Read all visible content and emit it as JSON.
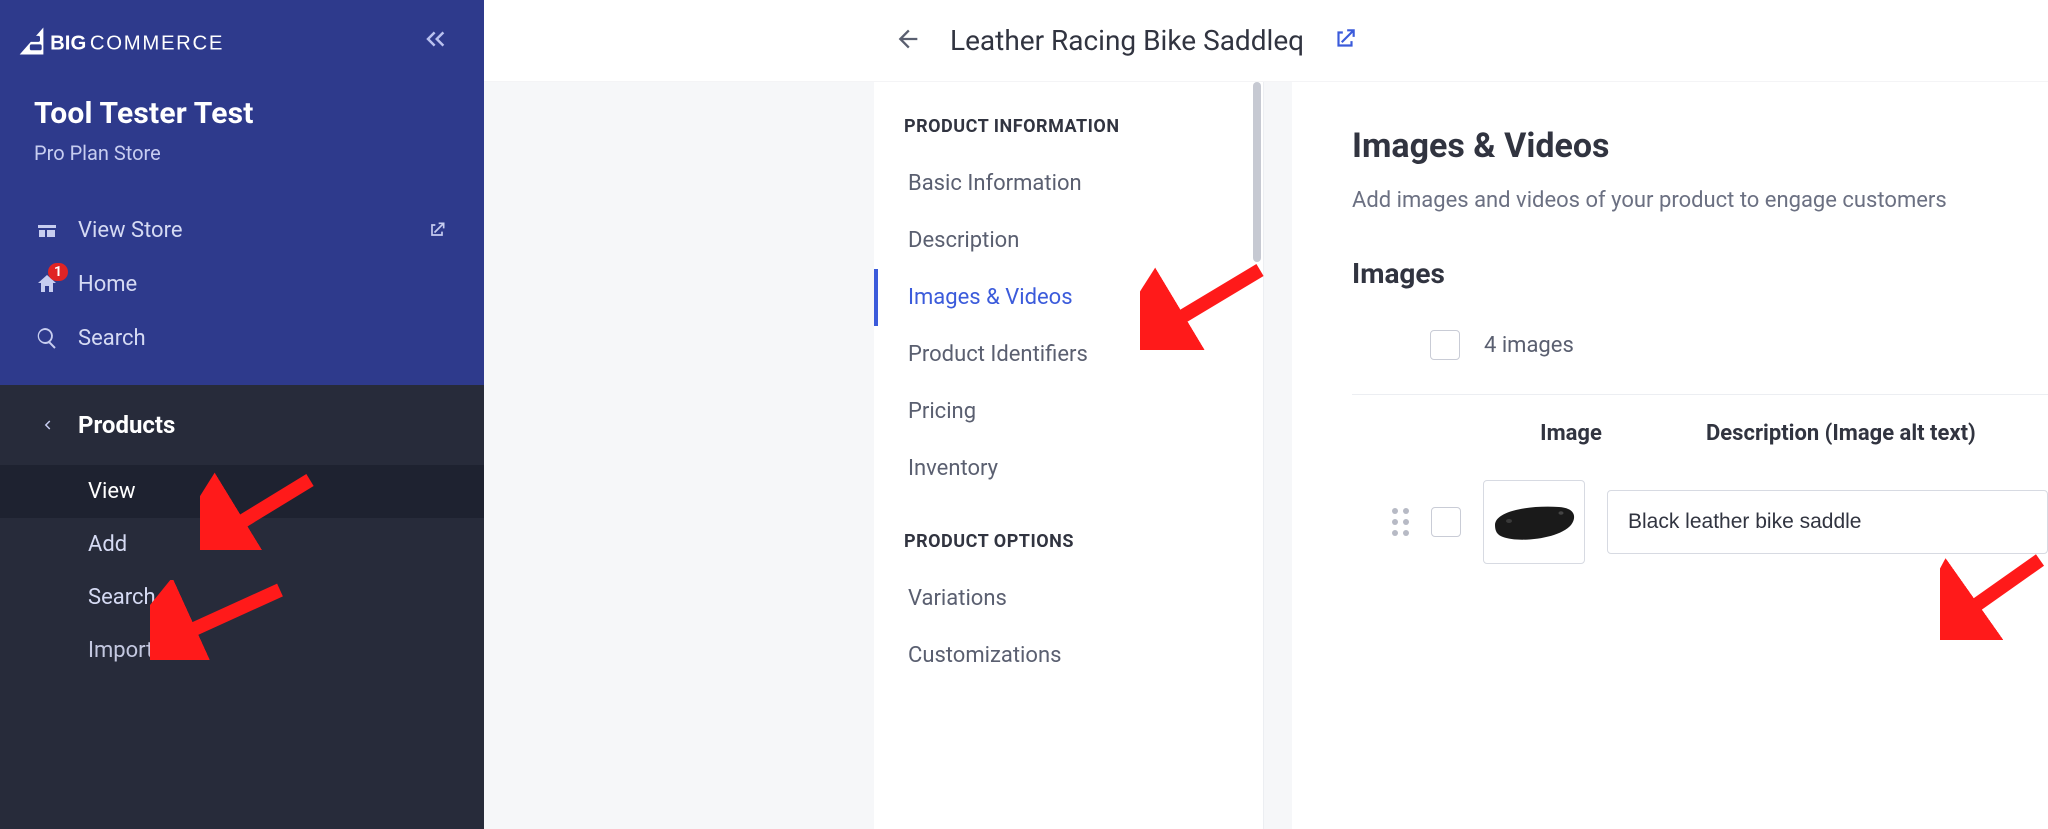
{
  "brand": {
    "name": "BIGCOMMERCE"
  },
  "store": {
    "name": "Tool Tester Test",
    "plan": "Pro Plan Store"
  },
  "sidebar": {
    "view_store": "View Store",
    "home": "Home",
    "home_badge": "1",
    "search": "Search",
    "products": {
      "label": "Products",
      "view": "View",
      "add": "Add",
      "search": "Search",
      "import": "Import"
    }
  },
  "header": {
    "title": "Leather Racing Bike Saddleq"
  },
  "section_nav": {
    "group1": "PRODUCT INFORMATION",
    "items1": {
      "basic": "Basic Information",
      "description": "Description",
      "images": "Images & Videos",
      "identifiers": "Product Identifiers",
      "pricing": "Pricing",
      "inventory": "Inventory"
    },
    "group2": "PRODUCT OPTIONS",
    "items2": {
      "variations": "Variations",
      "customizations": "Customizations"
    }
  },
  "content": {
    "title": "Images & Videos",
    "desc": "Add images and videos of your product to engage customers",
    "images_heading": "Images",
    "count_label": "4 images",
    "col_image": "Image",
    "col_desc": "Description (Image alt text)",
    "alt_text_value": "Black leather bike saddle"
  }
}
